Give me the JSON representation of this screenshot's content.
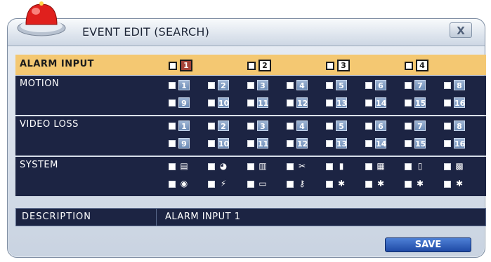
{
  "window": {
    "title": "EVENT EDIT (SEARCH)",
    "close_label": "X"
  },
  "rows": {
    "alarm_input": {
      "label": "ALARM INPUT",
      "channels": [
        "1",
        "2",
        "3",
        "4"
      ]
    },
    "motion": {
      "label": "MOTION",
      "channels": [
        "1",
        "2",
        "3",
        "4",
        "5",
        "6",
        "7",
        "8",
        "9",
        "10",
        "11",
        "12",
        "13",
        "14",
        "15",
        "16"
      ]
    },
    "video_loss": {
      "label": "VIDEO LOSS",
      "channels": [
        "1",
        "2",
        "3",
        "4",
        "5",
        "6",
        "7",
        "8",
        "9",
        "10",
        "11",
        "12",
        "13",
        "14",
        "15",
        "16"
      ]
    },
    "system": {
      "label": "SYSTEM",
      "icons": [
        "hdd-error-icon",
        "fan-error-icon",
        "disk-full-icon",
        "system-failure-icon",
        "power-fail-icon",
        "network-error-icon",
        "usb-error-icon",
        "matrix-error-icon",
        "login-icon",
        "power-on-icon",
        "print-icon",
        "key-error-icon",
        "fan-icon-1",
        "fan-icon-2",
        "fan-icon-3",
        "fan-icon-4"
      ]
    }
  },
  "description": {
    "label": "DESCRIPTION",
    "value": "ALARM INPUT 1"
  },
  "save_label": "SAVE",
  "colors": {
    "row_bg": "#1c2443",
    "highlight": "#f4c872",
    "accent_box": "#a6443a",
    "save": "#2b5cbd"
  }
}
